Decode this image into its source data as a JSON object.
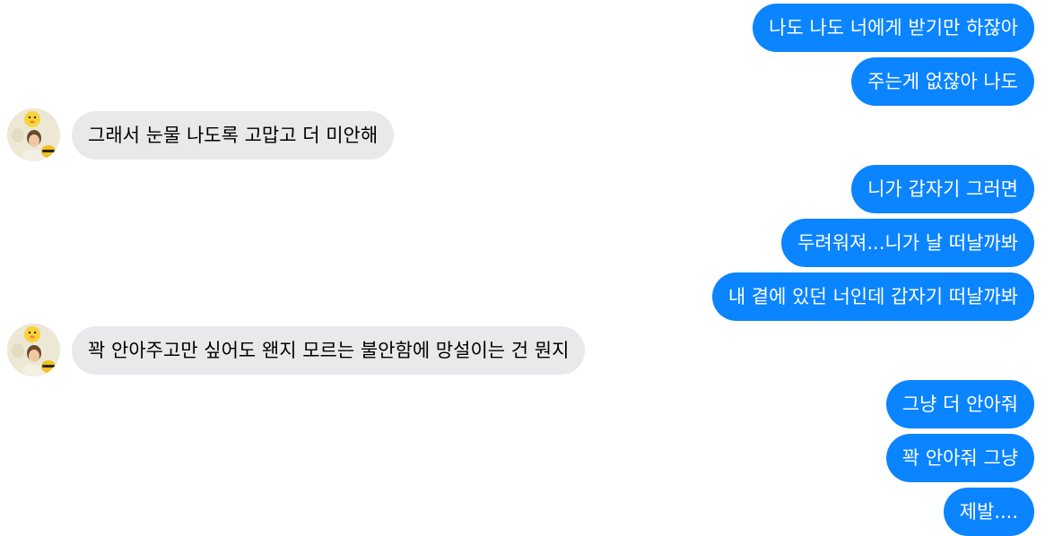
{
  "conversation": {
    "messages": [
      {
        "side": "sent",
        "text": "나도 나도 너에게 받기만 하잖아"
      },
      {
        "side": "sent",
        "text": "주는게 없잖아 나도"
      },
      {
        "side": "received",
        "text": "그래서 눈물 나도록 고맙고 더 미안해"
      },
      {
        "side": "sent",
        "text": "니가 갑자기 그러면"
      },
      {
        "side": "sent",
        "text": "두려워져...니가 날 떠날까봐"
      },
      {
        "side": "sent",
        "text": "내 곁에 있던 너인데 갑자기 떠날까봐"
      },
      {
        "side": "received",
        "text": "꽉 안아주고만 싶어도 왠지 모르는 불안함에 망설이는 건 뭔지"
      },
      {
        "side": "sent",
        "text": "그냥 더 안아줘"
      },
      {
        "side": "sent",
        "text": "꽉 안아줘 그냥"
      },
      {
        "side": "sent",
        "text": "제발...."
      }
    ]
  },
  "colors": {
    "sent_bubble": "#0b84ff",
    "received_bubble": "#e9e9eb"
  },
  "icons": {
    "avatar": "contact-avatar-photo"
  }
}
